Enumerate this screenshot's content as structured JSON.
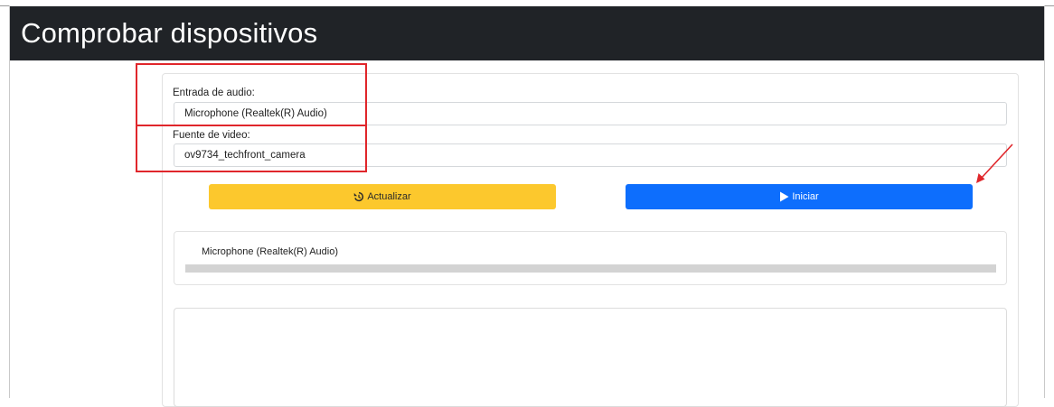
{
  "page": {
    "title": "Comprobar dispositivos"
  },
  "audio_input": {
    "label": "Entrada de audio:",
    "selected": "Microphone (Realtek(R) Audio)"
  },
  "video_source": {
    "label": "Fuente de video:",
    "selected": "ov9734_techfront_camera"
  },
  "buttons": {
    "refresh_label": "Actualizar",
    "refresh_icon": "history-icon",
    "start_label": "Iniciar",
    "start_icon": "play-icon"
  },
  "audio_meter": {
    "device_name": "Microphone (Realtek(R) Audio)",
    "level": 0
  },
  "colors": {
    "header_bg": "#202327",
    "refresh_button": "#fcc82d",
    "start_button": "#0d6efd",
    "annotation_red": "#e0262b"
  }
}
